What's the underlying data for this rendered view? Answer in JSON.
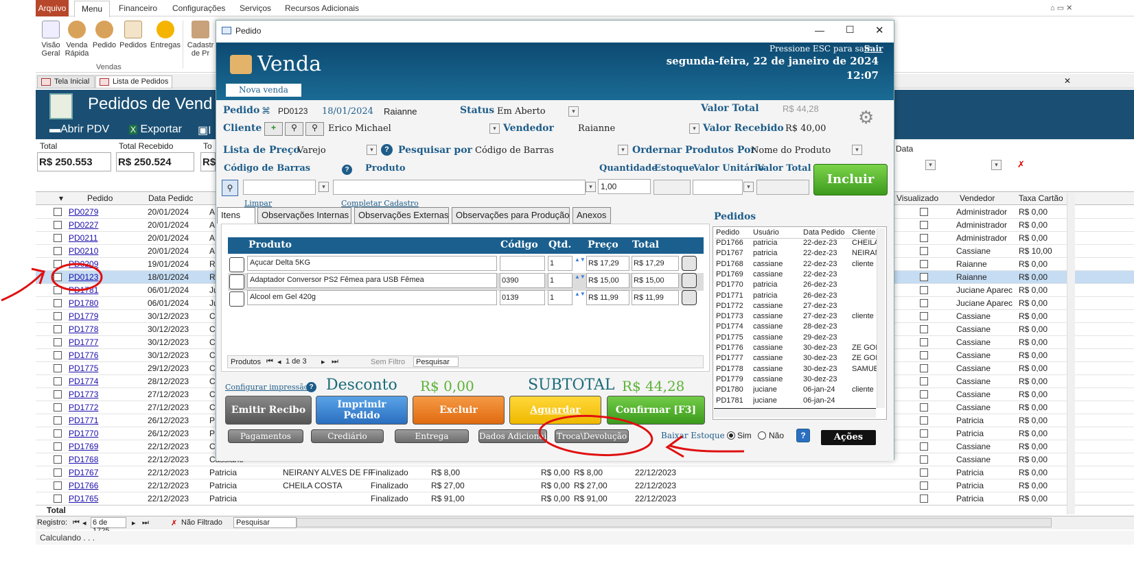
{
  "ribbon": {
    "tabs": [
      "Arquivo",
      "Menu",
      "Financeiro",
      "Configurações",
      "Serviços",
      "Recursos Adicionais"
    ],
    "buttons": [
      {
        "l1": "Visão",
        "l2": "Geral"
      },
      {
        "l1": "Venda",
        "l2": "Rápida"
      },
      {
        "l1": "Pedido",
        "l2": ""
      },
      {
        "l1": "Pedidos",
        "l2": ""
      },
      {
        "l1": "Entregas",
        "l2": ""
      },
      {
        "l1": "Cadastr",
        "l2": "de Pr"
      }
    ],
    "group": "Vendas"
  },
  "doc_tabs": [
    "Tela Inicial",
    "Lista de Pedidos"
  ],
  "bg_form": {
    "title": "Pedidos de Vend",
    "abrir_pdv": "Abrir PDV",
    "exportar": "Exportar",
    "imp_partial": "I",
    "totals": [
      {
        "label": "Total",
        "value": "R$ 250.553"
      },
      {
        "label": "Total Recebido",
        "value": "R$ 250.524"
      },
      {
        "label": "To",
        "value": "R$"
      }
    ],
    "data_label": "Data"
  },
  "grid": {
    "headers": {
      "pedido": "Pedido",
      "data": "Data Pedidc",
      "visualizado": "Visualizado",
      "vendedor": "Vendedor",
      "taxa": "Taxa Cartão"
    },
    "rows": [
      {
        "id": "PD0279",
        "date": "20/01/2024",
        "user": "A",
        "cli": "",
        "stat": "",
        "v1": "",
        "v2": "",
        "v3": "",
        "v4": "",
        "vend": "Administrador",
        "tax": "R$ 0,00"
      },
      {
        "id": "PD0227",
        "date": "20/01/2024",
        "user": "A",
        "cli": "",
        "stat": "",
        "v1": "",
        "v2": "",
        "v3": "",
        "v4": "",
        "vend": "Administrador",
        "tax": "R$ 0,00"
      },
      {
        "id": "PD0211",
        "date": "20/01/2024",
        "user": "A",
        "cli": "",
        "stat": "",
        "v1": "",
        "v2": "",
        "v3": "",
        "v4": "",
        "vend": "Administrador",
        "tax": "R$ 0,00"
      },
      {
        "id": "PD0210",
        "date": "20/01/2024",
        "user": "A",
        "cli": "",
        "stat": "",
        "v1": "",
        "v2": "",
        "v3": "",
        "v4": "",
        "vend": "Cassiane",
        "tax": "R$ 10,00"
      },
      {
        "id": "PD0209",
        "date": "19/01/2024",
        "user": "R",
        "cli": "",
        "stat": "",
        "v1": "",
        "v2": "",
        "v3": "",
        "v4": "",
        "vend": "Raianne",
        "tax": "R$ 0,00"
      },
      {
        "id": "PD0123",
        "date": "18/01/2024",
        "user": "R",
        "cli": "",
        "stat": "",
        "v1": "",
        "v2": "",
        "v3": "",
        "v4": "",
        "vend": "Raianne",
        "tax": "R$ 0,00"
      },
      {
        "id": "PD1781",
        "date": "06/01/2024",
        "user": "Ju",
        "cli": "",
        "stat": "",
        "v1": "",
        "v2": "",
        "v3": "",
        "v4": "",
        "vend": "Juciane Aparec",
        "tax": "R$ 0,00"
      },
      {
        "id": "PD1780",
        "date": "06/01/2024",
        "user": "Ju",
        "cli": "",
        "stat": "",
        "v1": "",
        "v2": "",
        "v3": "",
        "v4": "",
        "vend": "Juciane Aparec",
        "tax": "R$ 0,00"
      },
      {
        "id": "PD1779",
        "date": "30/12/2023",
        "user": "C",
        "cli": "",
        "stat": "",
        "v1": "",
        "v2": "",
        "v3": "",
        "v4": "",
        "vend": "Cassiane",
        "tax": "R$ 0,00"
      },
      {
        "id": "PD1778",
        "date": "30/12/2023",
        "user": "C",
        "cli": "",
        "stat": "",
        "v1": "",
        "v2": "",
        "v3": "",
        "v4": "",
        "vend": "Cassiane",
        "tax": "R$ 0,00"
      },
      {
        "id": "PD1777",
        "date": "30/12/2023",
        "user": "C",
        "cli": "",
        "stat": "",
        "v1": "",
        "v2": "",
        "v3": "",
        "v4": "",
        "vend": "Cassiane",
        "tax": "R$ 0,00"
      },
      {
        "id": "PD1776",
        "date": "30/12/2023",
        "user": "C",
        "cli": "",
        "stat": "",
        "v1": "",
        "v2": "",
        "v3": "",
        "v4": "",
        "vend": "Cassiane",
        "tax": "R$ 0,00"
      },
      {
        "id": "PD1775",
        "date": "29/12/2023",
        "user": "C",
        "cli": "",
        "stat": "",
        "v1": "",
        "v2": "",
        "v3": "",
        "v4": "",
        "vend": "Cassiane",
        "tax": "R$ 0,00"
      },
      {
        "id": "PD1774",
        "date": "28/12/2023",
        "user": "C",
        "cli": "",
        "stat": "",
        "v1": "",
        "v2": "",
        "v3": "",
        "v4": "",
        "vend": "Cassiane",
        "tax": "R$ 0,00"
      },
      {
        "id": "PD1773",
        "date": "27/12/2023",
        "user": "C",
        "cli": "",
        "stat": "",
        "v1": "",
        "v2": "",
        "v3": "",
        "v4": "",
        "vend": "Cassiane",
        "tax": "R$ 0,00"
      },
      {
        "id": "PD1772",
        "date": "27/12/2023",
        "user": "C",
        "cli": "",
        "stat": "",
        "v1": "",
        "v2": "",
        "v3": "",
        "v4": "",
        "vend": "Cassiane",
        "tax": "R$ 0,00"
      },
      {
        "id": "PD1771",
        "date": "26/12/2023",
        "user": "P",
        "cli": "",
        "stat": "",
        "v1": "",
        "v2": "",
        "v3": "",
        "v4": "",
        "vend": "Patricia",
        "tax": "R$ 0,00"
      },
      {
        "id": "PD1770",
        "date": "26/12/2023",
        "user": "P",
        "cli": "",
        "stat": "",
        "v1": "",
        "v2": "",
        "v3": "",
        "v4": "",
        "vend": "Patricia",
        "tax": "R$ 0,00"
      },
      {
        "id": "PD1769",
        "date": "22/12/2023",
        "user": "C",
        "cli": "",
        "stat": "",
        "v1": "",
        "v2": "",
        "v3": "",
        "v4": "",
        "vend": "Cassiane",
        "tax": "R$ 0,00"
      },
      {
        "id": "PD1768",
        "date": "22/12/2023",
        "user": "Cassiane",
        "cli": "",
        "stat": "",
        "v1": "",
        "v2": "",
        "v3": "",
        "v4": "",
        "vend": "Cassiane",
        "tax": "R$ 0,00"
      },
      {
        "id": "PD1767",
        "date": "22/12/2023",
        "user": "Patricia",
        "cli": "NEIRANY ALVES DE FF",
        "stat": "Finalizado",
        "v1": "R$ 8,00",
        "v2": "R$ 0,00",
        "v3": "R$ 8,00",
        "v4": "22/12/2023",
        "vend": "Patricia",
        "tax": "R$ 0,00"
      },
      {
        "id": "PD1766",
        "date": "22/12/2023",
        "user": "Patricia",
        "cli": "CHEILA COSTA",
        "stat": "Finalizado",
        "v1": "R$ 27,00",
        "v2": "R$ 0,00",
        "v3": "R$ 27,00",
        "v4": "22/12/2023",
        "vend": "Patricia",
        "tax": "R$ 0,00"
      },
      {
        "id": "PD1765",
        "date": "22/12/2023",
        "user": "Patricia",
        "cli": "",
        "stat": "Finalizado",
        "v1": "R$ 91,00",
        "v2": "R$ 0,00",
        "v3": "R$ 91,00",
        "v4": "22/12/2023",
        "vend": "Patricia",
        "tax": "R$ 0,00"
      }
    ],
    "total_label": "Total",
    "footer": {
      "registro": "Registro:",
      "nav": "6 de 1725",
      "filtro": "Não Filtrado",
      "pesquisar": "Pesquisar"
    }
  },
  "status": "Calculando . . .",
  "dialog": {
    "window_title": "Pedido",
    "head": {
      "title": "Venda",
      "esc_hint": "Pressione ESC para sair",
      "sair": "Sair",
      "date": "segunda-feira, 22 de janeiro de 2024",
      "time": "12:07",
      "nova_venda": "Nova venda"
    },
    "pedido_label": "Pedido",
    "pedido_num": "PD0123",
    "pedido_date": "18/01/2024",
    "pedido_user": "Raianne",
    "status_label": "Status",
    "status_value": "Em Aberto",
    "valor_total_label": "Valor Total",
    "valor_total_value": "R$ 44,28",
    "cliente_label": "Cliente",
    "cliente_value": "Erico Michael",
    "vendedor_label": "Vendedor",
    "vendedor_value": "Raianne",
    "valor_recebido_label": "Valor Recebido",
    "valor_recebido_value": "R$ 40,00",
    "lista_preco_label": "Lista de Preço",
    "lista_preco_value": "Varejo",
    "pesquisar_por_label": "Pesquisar por",
    "pesquisar_por_value": "Código de Barras",
    "ordenar_label": "Ordernar Produtos Por",
    "ordenar_value": "Nome do Produto",
    "col_codigo_barras": "Código de Barras",
    "col_produto": "Produto",
    "col_quantidade": "Quantidade",
    "col_estoque": "Estoque",
    "col_valor_unitario": "Valor Unitário",
    "col_valor_total": "Valor Total",
    "quantidade_value": "1,00",
    "incluir": "Incluir",
    "limpar": "Limpar",
    "completar": "Completar Cadastro",
    "tabs": [
      "Itens",
      "Observações Internas",
      "Observações Externas",
      "Observações para Produção",
      "Anexos"
    ],
    "items_header": {
      "produto": "Produto",
      "codigo": "Código",
      "qtd": "Qtd.",
      "preco": "Preço",
      "total": "Total"
    },
    "items": [
      {
        "produto": "Açucar Delta 5KG",
        "codigo": "",
        "qtd": "1",
        "preco": "R$ 17,29",
        "total": "R$ 17,29"
      },
      {
        "produto": "Adaptador Conversor PS2 Fêmea para USB Fêmea",
        "codigo": "0390",
        "qtd": "1",
        "preco": "R$ 15,00",
        "total": "R$ 15,00"
      },
      {
        "produto": "Alcool em Gel 420g",
        "codigo": "0139",
        "qtd": "1",
        "preco": "R$ 11,99",
        "total": "R$ 11,99"
      }
    ],
    "items_nav": {
      "produtos": "Produtos",
      "nav": "1 de 3",
      "filtro": "Sem Filtro",
      "pesquisar": "Pesquisar"
    },
    "pedidos_label": "Pedidos",
    "pedidos_header": {
      "pedido": "Pedido",
      "usuario": "Usuário",
      "data": "Data Pedido",
      "cliente": "Cliente"
    },
    "pedidos": [
      {
        "p": "PD1766",
        "u": "patricia",
        "d": "22-dez-23",
        "c": "CHEILA"
      },
      {
        "p": "PD1767",
        "u": "patricia",
        "d": "22-dez-23",
        "c": "NEIRAN"
      },
      {
        "p": "PD1768",
        "u": "cassiane",
        "d": "22-dez-23",
        "c": "cliente"
      },
      {
        "p": "PD1769",
        "u": "cassiane",
        "d": "22-dez-23",
        "c": ""
      },
      {
        "p": "PD1770",
        "u": "patricia",
        "d": "26-dez-23",
        "c": ""
      },
      {
        "p": "PD1771",
        "u": "patricia",
        "d": "26-dez-23",
        "c": ""
      },
      {
        "p": "PD1772",
        "u": "cassiane",
        "d": "27-dez-23",
        "c": ""
      },
      {
        "p": "PD1773",
        "u": "cassiane",
        "d": "27-dez-23",
        "c": "cliente"
      },
      {
        "p": "PD1774",
        "u": "cassiane",
        "d": "28-dez-23",
        "c": ""
      },
      {
        "p": "PD1775",
        "u": "cassiane",
        "d": "29-dez-23",
        "c": ""
      },
      {
        "p": "PD1776",
        "u": "cassiane",
        "d": "30-dez-23",
        "c": "ZE GOI"
      },
      {
        "p": "PD1777",
        "u": "cassiane",
        "d": "30-dez-23",
        "c": "ZE GOI"
      },
      {
        "p": "PD1778",
        "u": "cassiane",
        "d": "30-dez-23",
        "c": "SAMUE"
      },
      {
        "p": "PD1779",
        "u": "cassiane",
        "d": "30-dez-23",
        "c": ""
      },
      {
        "p": "PD1780",
        "u": "juciane",
        "d": "06-jan-24",
        "c": "cliente"
      },
      {
        "p": "PD1781",
        "u": "juciane",
        "d": "06-jan-24",
        "c": ""
      }
    ],
    "configurar": "Configurar impressão",
    "desconto_label": "Desconto",
    "desconto_value": "R$ 0,00",
    "subtotal_label": "SUBTOTAL",
    "subtotal_value": "R$ 44,28",
    "buttons": {
      "emitir": "Emitir Recibo",
      "imprimir1": "Imprimir",
      "imprimir2": "Pedido",
      "excluir": "Excluir",
      "aguardar": "Aguardar",
      "confirmar": "Confirmar [F3]"
    },
    "small_buttons": [
      "Pagamentos",
      "Crediário",
      "Entrega",
      "Dados Adicionais",
      "Troca\\Devolução"
    ],
    "baixar_estoque": "Baixar Estoque",
    "sim": "Sim",
    "nao": "Não",
    "acoes": "Ações"
  },
  "colors": {
    "accent_blue": "#1a5f8e",
    "annotation_red": "#e01010",
    "green": "#5cb336",
    "orange": "#f07820",
    "yellow": "#f5c400"
  }
}
